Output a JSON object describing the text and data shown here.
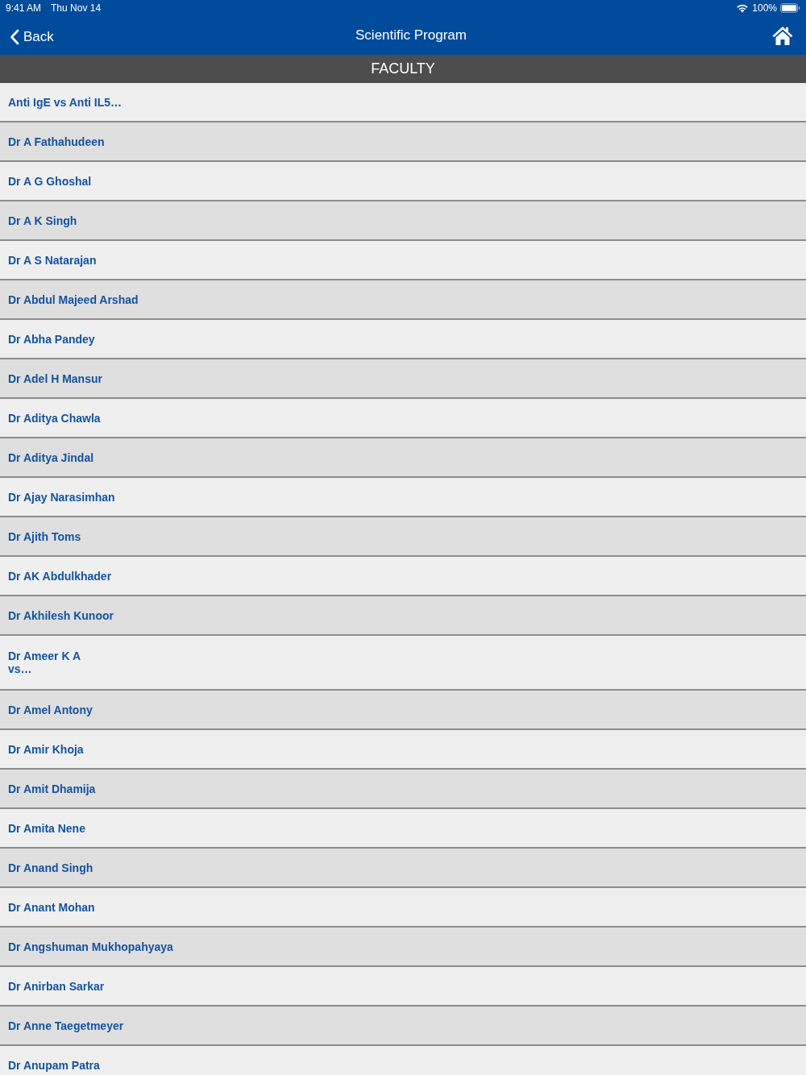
{
  "status_bar": {
    "time": "9:41 AM",
    "date": "Thu Nov 14",
    "battery": "100%"
  },
  "nav_bar": {
    "back": "Back",
    "title": "Scientific Program"
  },
  "section": {
    "title": "FACULTY"
  },
  "items": [
    "Anti IgE vs Anti IL5…",
    "Dr A Fathahudeen",
    "Dr A G Ghoshal",
    "Dr A K Singh",
    "Dr A S Natarajan",
    "Dr Abdul Majeed Arshad",
    "Dr Abha Pandey",
    "Dr Adel H Mansur",
    "Dr Aditya Chawla",
    "Dr Aditya Jindal",
    "Dr Ajay Narasimhan",
    "Dr Ajith Toms",
    "Dr AK Abdulkhader",
    "Dr Akhilesh Kunoor",
    "Dr Ameer K A\nvs…",
    "Dr Amel Antony",
    "Dr Amir Khoja",
    "Dr Amit Dhamija",
    "Dr Amita Nene",
    "Dr Anand Singh",
    "Dr Anant Mohan",
    "Dr Angshuman Mukhopahyaya",
    "Dr Anirban Sarkar",
    "Dr Anne Taegetmeyer",
    "Dr Anupam Patra"
  ]
}
